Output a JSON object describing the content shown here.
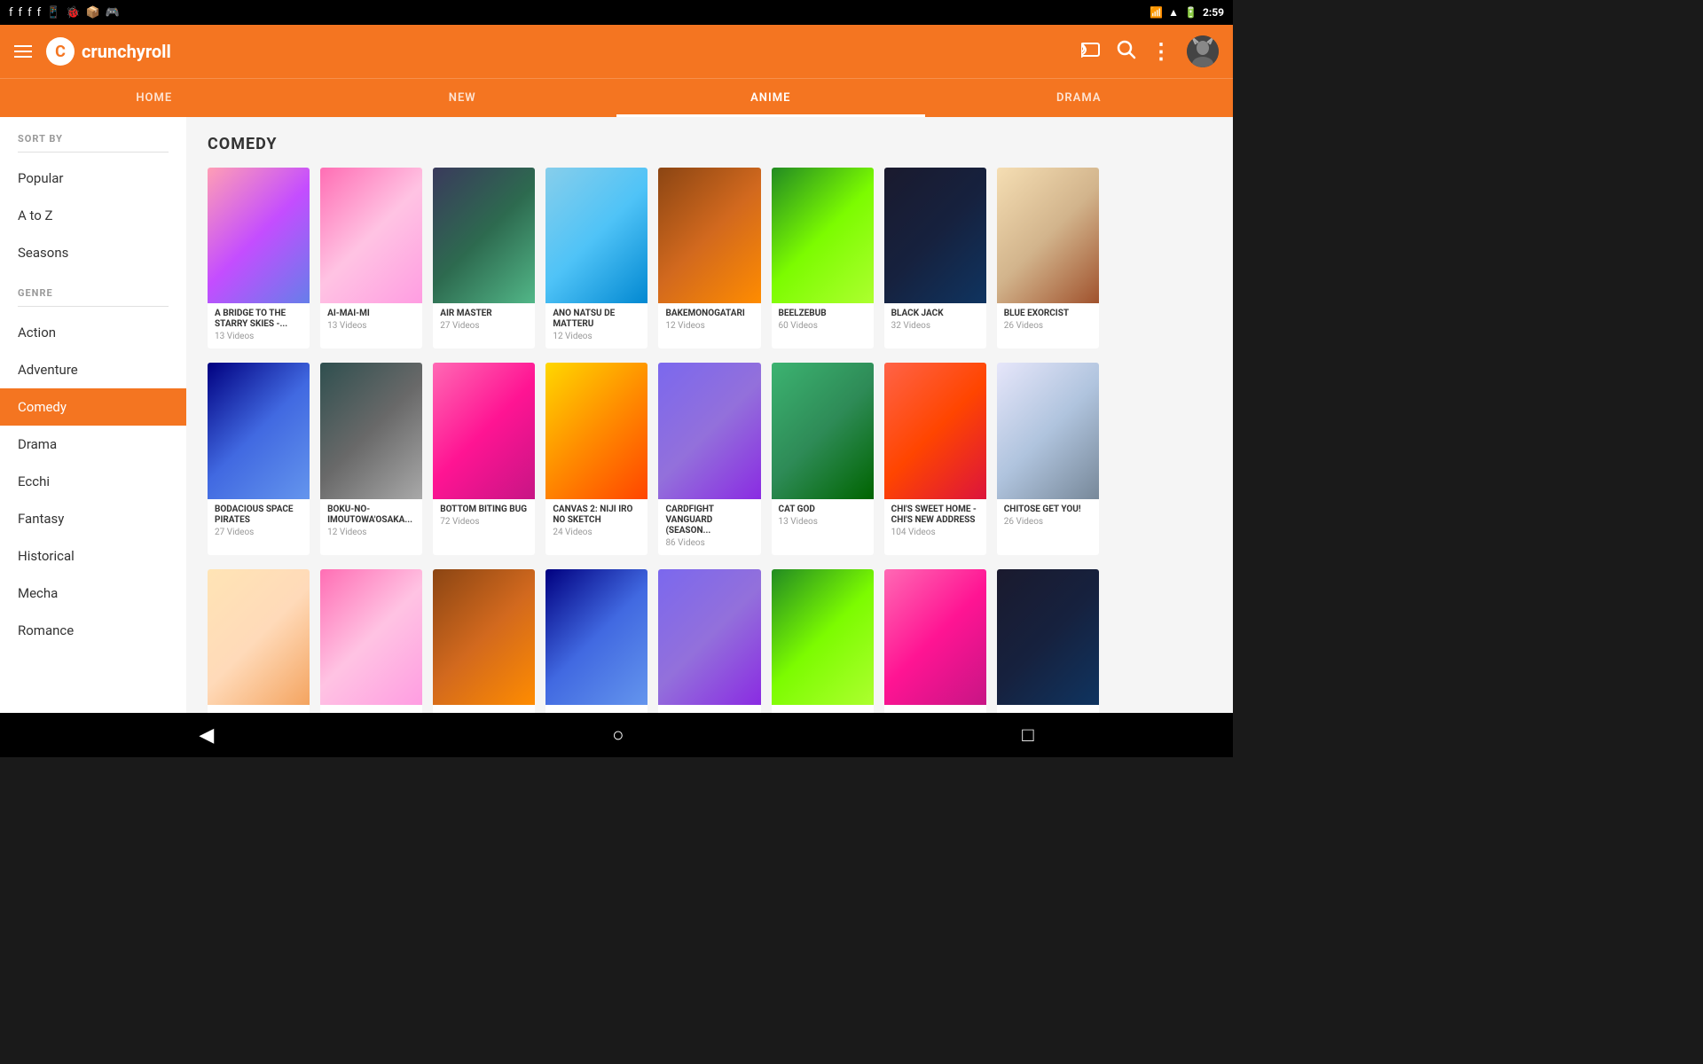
{
  "statusBar": {
    "time": "2:59",
    "icons": [
      "fb1",
      "fb2",
      "fb3",
      "fb4",
      "phone",
      "bug",
      "app1",
      "app2"
    ]
  },
  "header": {
    "logoText": "crunchyroll",
    "castLabel": "cast",
    "searchLabel": "search",
    "moreLabel": "more"
  },
  "navTabs": [
    {
      "id": "home",
      "label": "HOME",
      "active": false
    },
    {
      "id": "new",
      "label": "NEW",
      "active": false
    },
    {
      "id": "anime",
      "label": "ANIME",
      "active": true
    },
    {
      "id": "drama",
      "label": "DRAMA",
      "active": false
    }
  ],
  "sidebar": {
    "sortByLabel": "SORT BY",
    "sortItems": [
      {
        "id": "popular",
        "label": "Popular"
      },
      {
        "id": "a-to-z",
        "label": "A to Z"
      },
      {
        "id": "seasons",
        "label": "Seasons"
      }
    ],
    "genreLabel": "GENRE",
    "genreItems": [
      {
        "id": "action",
        "label": "Action"
      },
      {
        "id": "adventure",
        "label": "Adventure"
      },
      {
        "id": "comedy",
        "label": "Comedy",
        "active": true
      },
      {
        "id": "drama",
        "label": "Drama"
      },
      {
        "id": "ecchi",
        "label": "Ecchi"
      },
      {
        "id": "fantasy",
        "label": "Fantasy"
      },
      {
        "id": "historical",
        "label": "Historical"
      },
      {
        "id": "mecha",
        "label": "Mecha"
      },
      {
        "id": "romance",
        "label": "Romance"
      }
    ]
  },
  "content": {
    "sectionTitle": "COMEDY",
    "rows": [
      {
        "cards": [
          {
            "id": 1,
            "title": "A BRIDGE TO THE STARRY SKIES -...",
            "videos": "13 Videos",
            "thumbClass": "thumb-1"
          },
          {
            "id": 2,
            "title": "AI-MAI-MI",
            "videos": "13 Videos",
            "thumbClass": "thumb-2"
          },
          {
            "id": 3,
            "title": "AIR MASTER",
            "videos": "27 Videos",
            "thumbClass": "thumb-3"
          },
          {
            "id": 4,
            "title": "ANO NATSU DE MATTERU",
            "videos": "12 Videos",
            "thumbClass": "thumb-4"
          },
          {
            "id": 5,
            "title": "BAKEMONOGATARI",
            "videos": "12 Videos",
            "thumbClass": "thumb-5"
          },
          {
            "id": 6,
            "title": "BEELZEBUB",
            "videos": "60 Videos",
            "thumbClass": "thumb-6"
          },
          {
            "id": 7,
            "title": "BLACK JACK",
            "videos": "32 Videos",
            "thumbClass": "thumb-7"
          },
          {
            "id": 8,
            "title": "BLUE EXORCIST",
            "videos": "26 Videos",
            "thumbClass": "thumb-8"
          }
        ]
      },
      {
        "cards": [
          {
            "id": 9,
            "title": "BODACIOUS SPACE PIRATES",
            "videos": "27 Videos",
            "thumbClass": "thumb-9"
          },
          {
            "id": 10,
            "title": "BOKU-NO-IMOUTOWA'OSAKA...",
            "videos": "12 Videos",
            "thumbClass": "thumb-10"
          },
          {
            "id": 11,
            "title": "BOTTOM BITING BUG",
            "videos": "72 Videos",
            "thumbClass": "thumb-11"
          },
          {
            "id": 12,
            "title": "CANVAS 2: NIJI IRO NO SKETCH",
            "videos": "24 Videos",
            "thumbClass": "thumb-12"
          },
          {
            "id": 13,
            "title": "CARDFIGHT VANGUARD (SEASON...",
            "videos": "86 Videos",
            "thumbClass": "thumb-13"
          },
          {
            "id": 14,
            "title": "CAT GOD",
            "videos": "13 Videos",
            "thumbClass": "thumb-14"
          },
          {
            "id": 15,
            "title": "CHI'S SWEET HOME - CHI'S NEW ADDRESS",
            "videos": "104 Videos",
            "thumbClass": "thumb-15"
          },
          {
            "id": 16,
            "title": "CHITOSE GET YOU!",
            "videos": "26 Videos",
            "thumbClass": "thumb-16"
          }
        ]
      },
      {
        "cards": [
          {
            "id": 17,
            "title": "",
            "videos": "",
            "thumbClass": "thumb-17"
          },
          {
            "id": 18,
            "title": "",
            "videos": "",
            "thumbClass": "thumb-2"
          },
          {
            "id": 19,
            "title": "",
            "videos": "",
            "thumbClass": "thumb-5"
          },
          {
            "id": 20,
            "title": "",
            "videos": "",
            "thumbClass": "thumb-9"
          },
          {
            "id": 21,
            "title": "",
            "videos": "",
            "thumbClass": "thumb-13"
          },
          {
            "id": 22,
            "title": "",
            "videos": "",
            "thumbClass": "thumb-6"
          },
          {
            "id": 23,
            "title": "",
            "videos": "",
            "thumbClass": "thumb-11"
          },
          {
            "id": 24,
            "title": "",
            "videos": "",
            "thumbClass": "thumb-7"
          }
        ]
      }
    ]
  },
  "bottomBar": {
    "backIcon": "◀",
    "homeIcon": "○",
    "recentIcon": "□"
  },
  "colors": {
    "orange": "#f47521",
    "dark": "#1a1a1a",
    "white": "#ffffff"
  }
}
